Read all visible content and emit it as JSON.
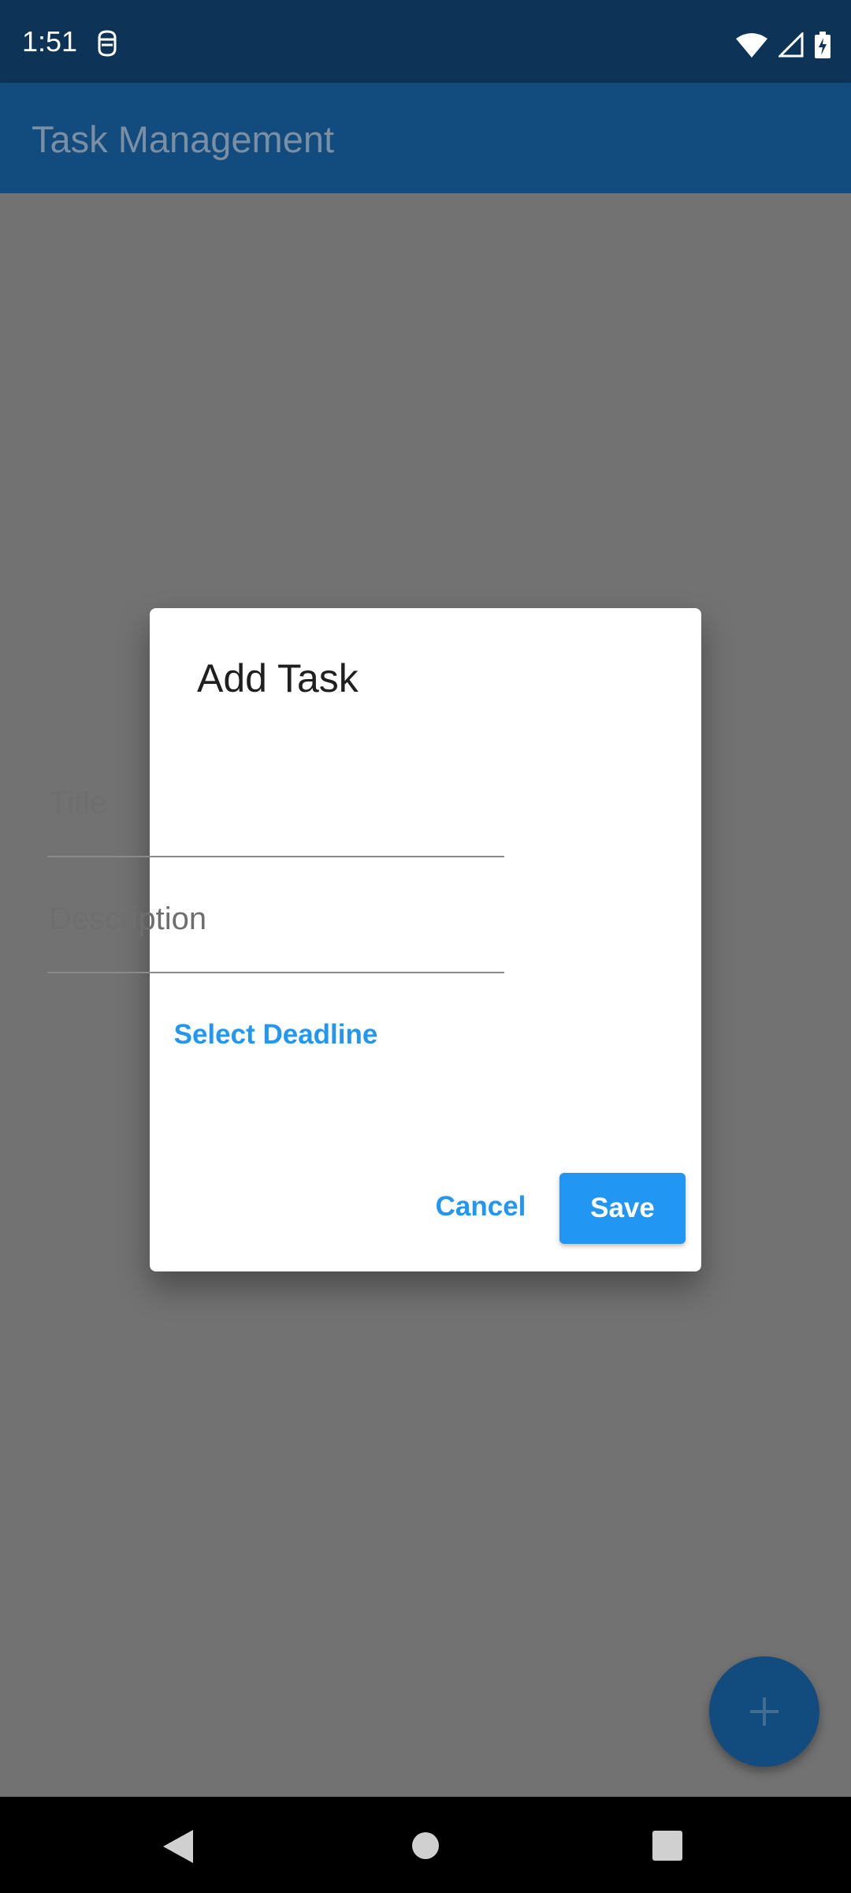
{
  "status_bar": {
    "time": "1:51"
  },
  "app_bar": {
    "title": "Task Management"
  },
  "dialog": {
    "title": "Add Task",
    "title_field": {
      "placeholder": "Title",
      "value": ""
    },
    "description_field": {
      "placeholder": "Description",
      "value": ""
    },
    "select_deadline_label": "Select Deadline",
    "cancel_label": "Cancel",
    "save_label": "Save"
  },
  "icons": {
    "status_left": "notification-icon",
    "wifi": "wifi-icon",
    "signal": "signal-icon",
    "battery": "battery-icon",
    "fab": "plus-icon",
    "nav_back": "back-icon",
    "nav_home": "home-icon",
    "nav_recents": "recents-icon"
  },
  "colors": {
    "status_bar": "#0d3457",
    "app_bar": "#124b7d",
    "scrim": "#727272",
    "accent": "#2196f3"
  }
}
